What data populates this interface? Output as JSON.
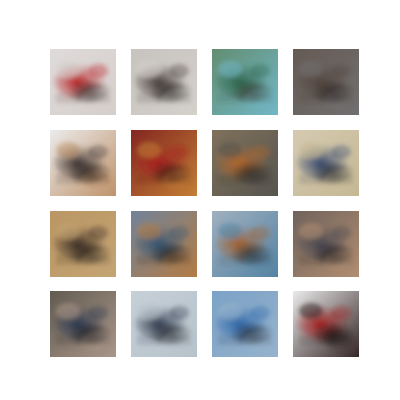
{
  "figure": {
    "rows": 4,
    "cols": 4,
    "background": "#ffffff",
    "tiles": [
      {
        "row": 0,
        "col": 0,
        "description_colors": {
          "primary": "#c81f22",
          "secondary": "#e8e0dc",
          "dark": "#2a1d1a",
          "background": "#f2eeee"
        }
      },
      {
        "row": 0,
        "col": 1,
        "description_colors": {
          "primary": "#4a3f3b",
          "secondary": "#e6e2dc",
          "dark": "#1f1b1a",
          "background": "#d9d4cf"
        }
      },
      {
        "row": 0,
        "col": 2,
        "description_colors": {
          "primary": "#2f6b51",
          "secondary": "#7cc7d8",
          "dark": "#3b3a2c",
          "background": "#6b9a7b"
        }
      },
      {
        "row": 0,
        "col": 3,
        "description_colors": {
          "primary": "#5a4b43",
          "secondary": "#7b7a7a",
          "dark": "#2f2624",
          "background": "#6e625c"
        }
      },
      {
        "row": 1,
        "col": 0,
        "description_colors": {
          "primary": "#3b3131",
          "secondary": "#d0a074",
          "dark": "#1a1414",
          "background": "#ffffff"
        }
      },
      {
        "row": 1,
        "col": 1,
        "description_colors": {
          "primary": "#b41f22",
          "secondary": "#d48a3b",
          "dark": "#3a1c16",
          "background": "#8f2a23"
        }
      },
      {
        "row": 1,
        "col": 2,
        "description_colors": {
          "primary": "#c66f2c",
          "secondary": "#5e5d56",
          "dark": "#2d2723",
          "background": "#8b7b63"
        }
      },
      {
        "row": 1,
        "col": 3,
        "description_colors": {
          "primary": "#344a77",
          "secondary": "#d7c8a1",
          "dark": "#1a1f2c",
          "background": "#e7dcc1"
        }
      },
      {
        "row": 2,
        "col": 0,
        "description_colors": {
          "primary": "#3e2f27",
          "secondary": "#d6b27e",
          "dark": "#1b1714",
          "background": "#c9a36c"
        }
      },
      {
        "row": 2,
        "col": 1,
        "description_colors": {
          "primary": "#335a7c",
          "secondary": "#c3874b",
          "dark": "#1a1f25",
          "background": "#7b8ea7"
        }
      },
      {
        "row": 2,
        "col": 2,
        "description_colors": {
          "primary": "#b4652c",
          "secondary": "#5b8fb1",
          "dark": "#2b2a28",
          "background": "#aebfd0"
        }
      },
      {
        "row": 2,
        "col": 3,
        "description_colors": {
          "primary": "#4b4b57",
          "secondary": "#c09a7b",
          "dark": "#1f1d22",
          "background": "#7a6b64"
        }
      },
      {
        "row": 3,
        "col": 0,
        "description_colors": {
          "primary": "#2d3c57",
          "secondary": "#b9a396",
          "dark": "#1a1a1d",
          "background": "#6b6458"
        }
      },
      {
        "row": 3,
        "col": 1,
        "description_colors": {
          "primary": "#2e3a4f",
          "secondary": "#c7d3dc",
          "dark": "#1f2227",
          "background": "#d8e2ea"
        }
      },
      {
        "row": 3,
        "col": 2,
        "description_colors": {
          "primary": "#2f6db6",
          "secondary": "#a3c2de",
          "dark": "#1d2430",
          "background": "#86b0d7"
        }
      },
      {
        "row": 3,
        "col": 3,
        "description_colors": {
          "primary": "#b41a1a",
          "secondary": "#3a2a2a",
          "dark": "#1a1111",
          "background": "#ffffff"
        }
      }
    ]
  }
}
